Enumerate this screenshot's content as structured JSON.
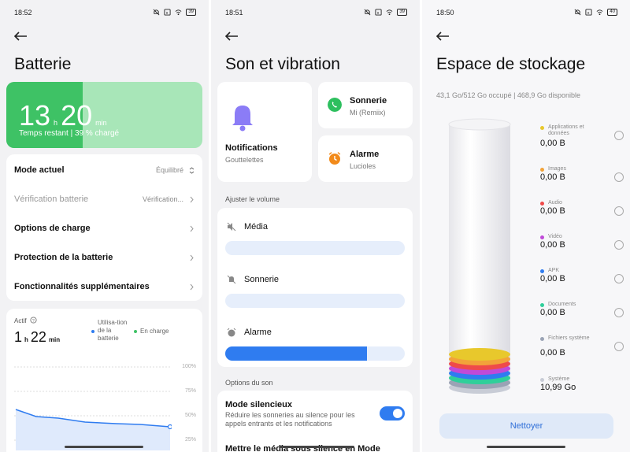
{
  "panel1": {
    "status": {
      "time": "18:52",
      "battery": "39"
    },
    "title": "Batterie",
    "battery": {
      "hours": "13",
      "h": "h",
      "minutes": "20",
      "min": "min",
      "subtitle": "Temps restant | 39 % chargé",
      "level_percent": 39
    },
    "menu": [
      {
        "label": "Mode actuel",
        "value": "Équilibré",
        "enabled": true
      },
      {
        "label": "Vérification batterie",
        "value": "Vérification...",
        "enabled": false
      },
      {
        "label": "Options de charge",
        "value": "",
        "enabled": true
      },
      {
        "label": "Protection de la batterie",
        "value": "",
        "enabled": true
      },
      {
        "label": "Fonctionnalités supplémentaires",
        "value": "",
        "enabled": true
      }
    ],
    "usage": {
      "actif": "Actif",
      "hours": "1",
      "h": "h",
      "minutes": "22",
      "min": "min",
      "legend_usage": "Utilisa-tion de la batterie",
      "legend_charge": "En charge",
      "ticks": [
        "100%",
        "75%",
        "50%",
        "25%"
      ],
      "colors": {
        "usage": "#2f7cf0",
        "charge": "#3ec265"
      }
    }
  },
  "panel2": {
    "status": {
      "time": "18:51",
      "battery": "39"
    },
    "title": "Son et vibration",
    "notifications": {
      "title": "Notifications",
      "subtitle": "Gouttelettes"
    },
    "ringtone": {
      "title": "Sonnerie",
      "subtitle": "Mi (Remiix)",
      "color": "#2dbf5e"
    },
    "alarm": {
      "title": "Alarme",
      "subtitle": "Lucioles",
      "color": "#f28a1a"
    },
    "volume_section": "Ajuster le volume",
    "volumes": [
      {
        "label": "Média",
        "level": 0
      },
      {
        "label": "Sonnerie",
        "level": 0
      },
      {
        "label": "Alarme",
        "level": 0.79
      }
    ],
    "sound_section": "Options du son",
    "silent": {
      "title": "Mode silencieux",
      "subtitle": "Réduire les sonneries au silence pour les appels entrants et les notifications",
      "enabled": true
    },
    "next_row": "Mettre le média sous silence en Mode"
  },
  "panel3": {
    "status": {
      "time": "18:50",
      "battery": "40"
    },
    "title": "Espace de stockage",
    "summary": "43,1 Go/512 Go occupé | 468,9 Go disponible",
    "items": [
      {
        "name": "Applications et données",
        "value": "0,00 B",
        "color": "#e8c82c",
        "radio": true
      },
      {
        "name": "Images",
        "value": "0,00 B",
        "color": "#f2a33a",
        "radio": true
      },
      {
        "name": "Audio",
        "value": "0,00 B",
        "color": "#ef4a4a",
        "radio": true
      },
      {
        "name": "Vidéo",
        "value": "0,00 B",
        "color": "#c04ad8",
        "radio": true
      },
      {
        "name": "APK",
        "value": "0,00 B",
        "color": "#2f7cf0",
        "radio": true
      },
      {
        "name": "Documents",
        "value": "0,00 B",
        "color": "#2fcf9a",
        "radio": true
      },
      {
        "name": "Fichiers système",
        "value": "0,00 B",
        "color": "#9aa3b5",
        "radio": true
      },
      {
        "name": "Système",
        "value": "10,99 Go",
        "color": "#c8ccd6",
        "radio": false
      }
    ],
    "clean_button": "Nettoyer"
  }
}
